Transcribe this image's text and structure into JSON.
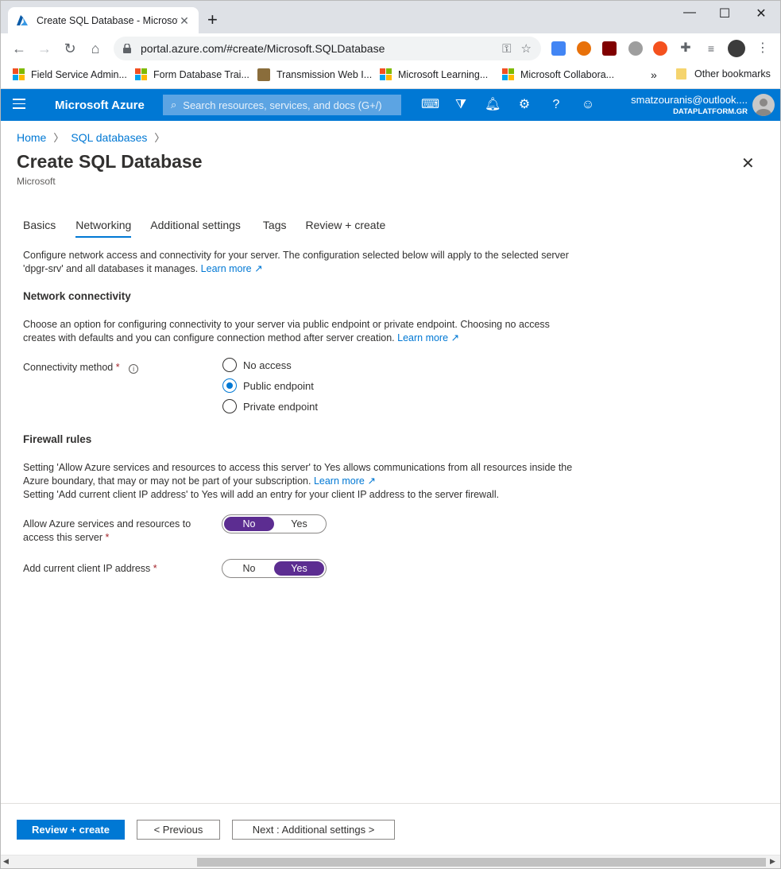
{
  "browser": {
    "tab_title": "Create SQL Database - Microsoft",
    "url": "portal.azure.com/#create/Microsoft.SQLDatabase",
    "bookmarks": [
      {
        "label": "Field Service Admin..."
      },
      {
        "label": "Form Database Trai..."
      },
      {
        "label": "Transmission Web I..."
      },
      {
        "label": "Microsoft Learning..."
      },
      {
        "label": "Microsoft Collabora..."
      }
    ],
    "overflow": "»",
    "other_bookmarks": "Other bookmarks"
  },
  "azure": {
    "brand": "Microsoft Azure",
    "search_placeholder": "Search resources, services, and docs (G+/)",
    "account_email": "smatzouranis@outlook....",
    "account_directory": "DATAPLATFORM.GR"
  },
  "breadcrumb": {
    "home": "Home",
    "sql": "SQL databases"
  },
  "page": {
    "title": "Create SQL Database",
    "subtitle": "Microsoft"
  },
  "tabs": [
    {
      "label": "Basics"
    },
    {
      "label": "Networking"
    },
    {
      "label": "Additional settings"
    },
    {
      "label": "Tags"
    },
    {
      "label": "Review + create"
    }
  ],
  "intro": {
    "text": "Configure network access and connectivity for your server. The configuration selected below will apply to the selected server 'dpgr-srv' and all databases it manages.",
    "link": "Learn more"
  },
  "network": {
    "heading": "Network connectivity",
    "text": "Choose an option for configuring connectivity to your server via public endpoint or private endpoint. Choosing no access creates with defaults and you can configure connection method after server creation.",
    "link": "Learn more",
    "method_label": "Connectivity method",
    "required": "*",
    "options": [
      {
        "label": "No access"
      },
      {
        "label": "Public endpoint"
      },
      {
        "label": "Private endpoint"
      }
    ],
    "selected": "Public endpoint"
  },
  "firewall": {
    "heading": "Firewall rules",
    "text1": "Setting 'Allow Azure services and resources to access this server' to Yes allows communications from all resources inside the Azure boundary, that may or may not be part of your subscription.",
    "link": "Learn more",
    "text2": "Setting 'Add current client IP address' to Yes will add an entry for your client IP address to the server firewall.",
    "allow_label": "Allow Azure services and resources to access this server",
    "allow_value": "No",
    "client_ip_label": "Add current client IP address",
    "client_ip_value": "Yes",
    "no": "No",
    "yes": "Yes",
    "required": "*"
  },
  "footer": {
    "review": "Review + create",
    "previous": "< Previous",
    "next": "Next : Additional settings >"
  },
  "colors": {
    "azure_blue": "#0078d4",
    "toggle_on": "#5c2d91",
    "required": "#a4262c"
  }
}
